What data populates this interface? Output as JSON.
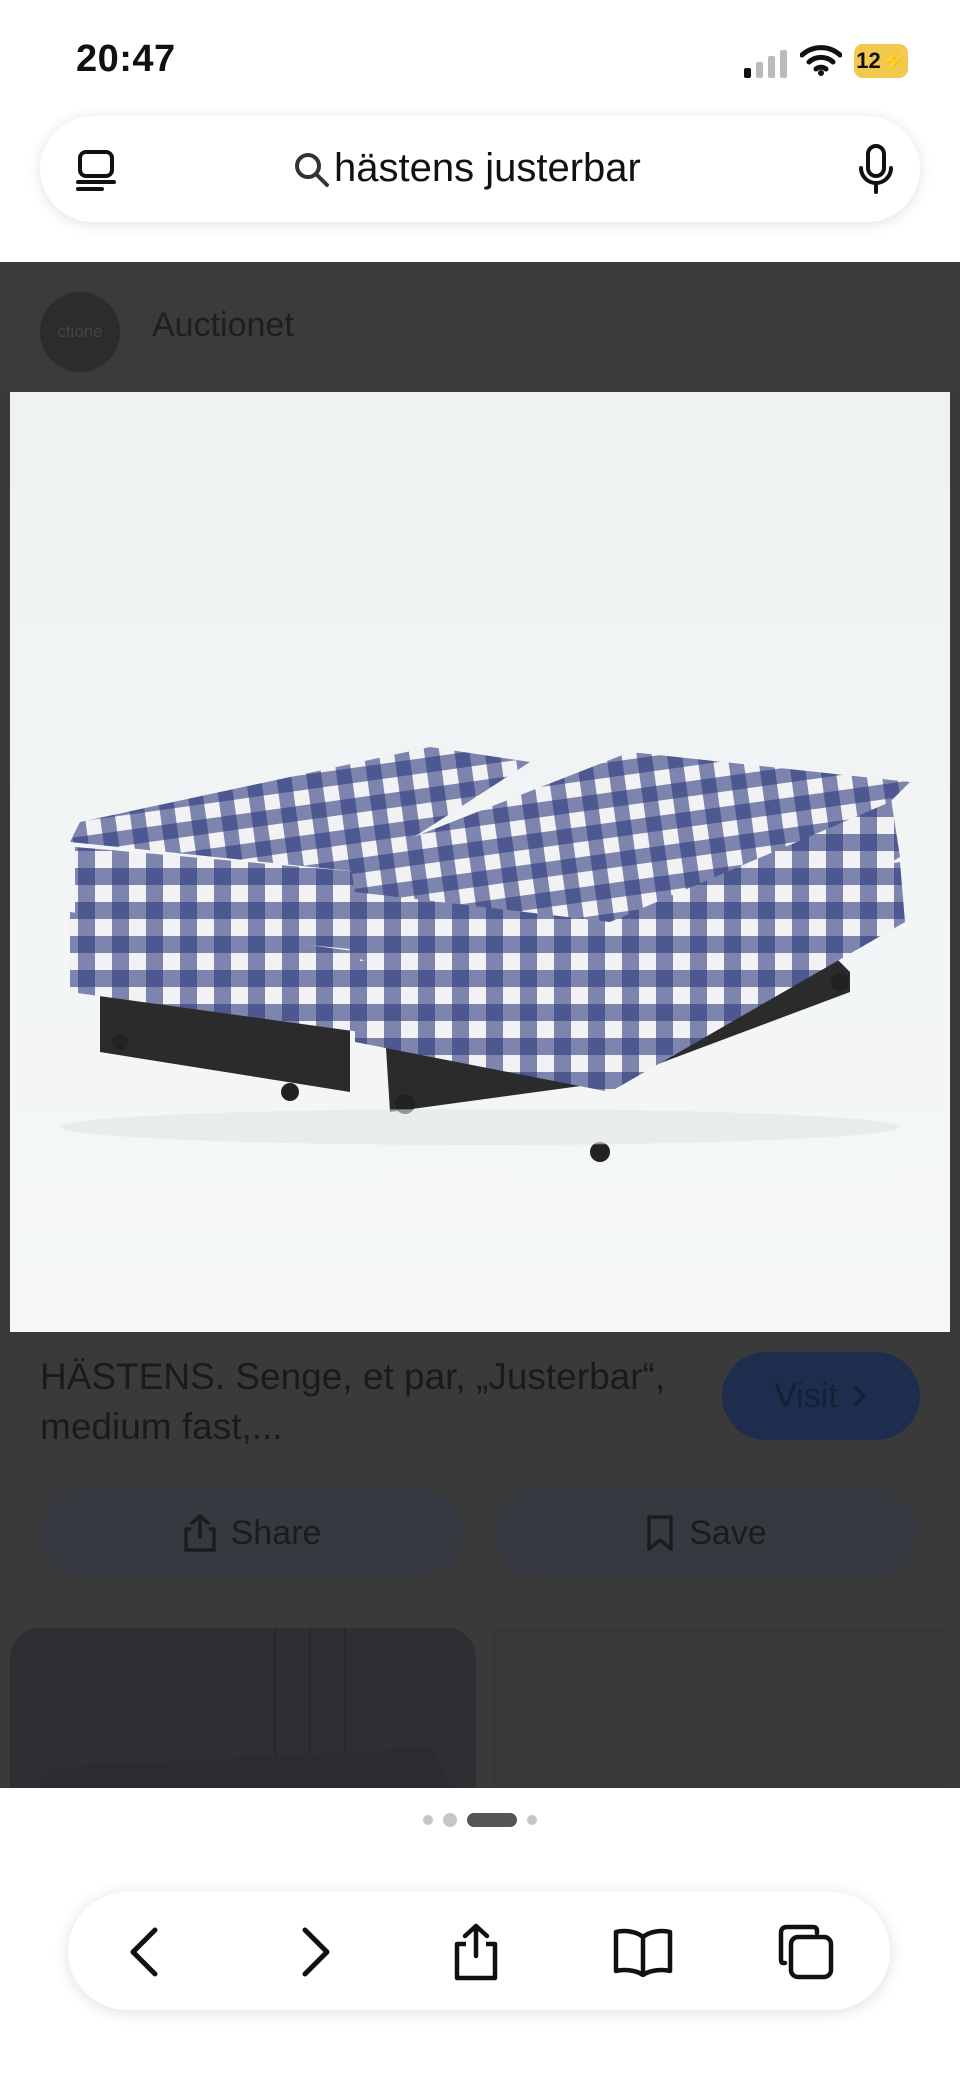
{
  "status_bar": {
    "time": "20:47",
    "battery": "12"
  },
  "search": {
    "query": "hästens justerbar"
  },
  "result": {
    "source_logo_text": "ctione",
    "source_name": "Auctionet",
    "image_alt": "Hästens Justerbar beds",
    "title": "HÄSTENS. Senge, et par, „Justerbar“, medium fast,...",
    "visit_label": "Visit",
    "share_label": "Share",
    "save_label": "Save"
  },
  "colors": {
    "bed_blue": "#2e3a7d",
    "dim_overlay": "#3a3a3a",
    "battery": "#f2c94c"
  },
  "icons": [
    "tabs-icon",
    "search-icon",
    "mic-icon",
    "share-icon",
    "bookmark-icon",
    "back-icon",
    "forward-icon",
    "book-icon",
    "tabs-overview-icon"
  ],
  "page_indicator": {
    "count": 4,
    "active": 3
  }
}
